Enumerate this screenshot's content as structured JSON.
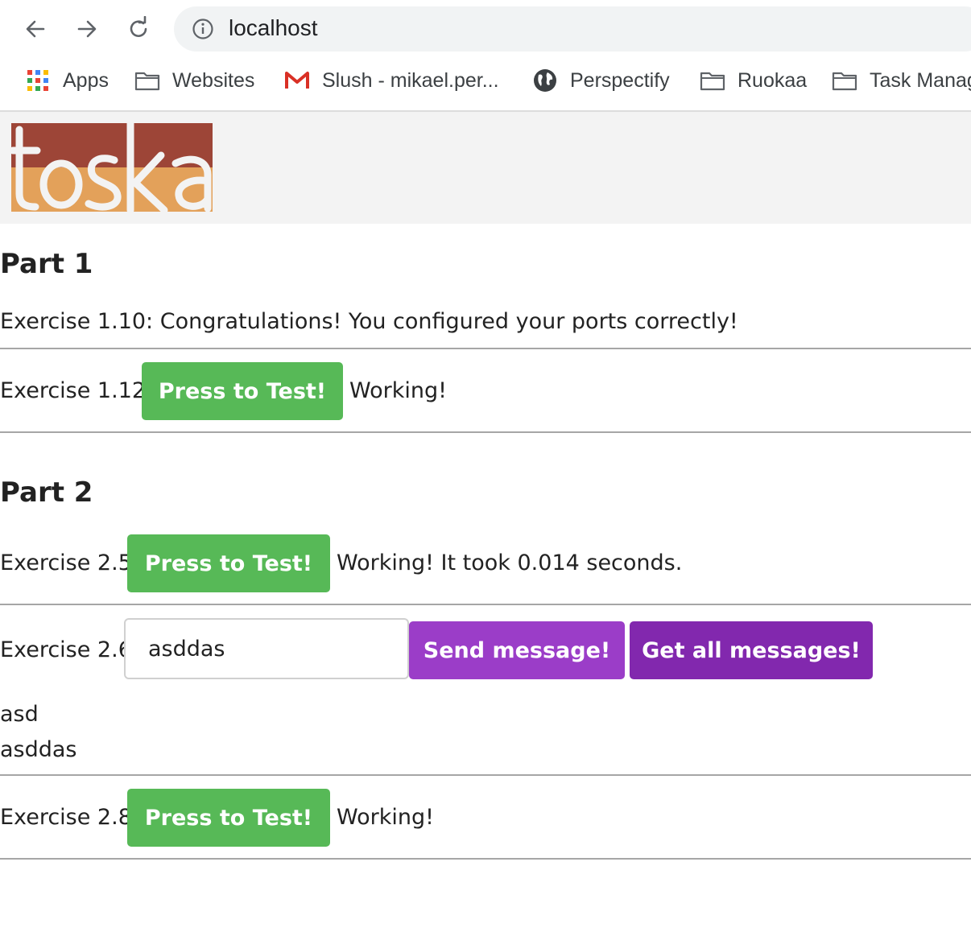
{
  "browser": {
    "url": "localhost",
    "bookmarks": [
      {
        "label": "Apps",
        "icon": "apps-grid-icon"
      },
      {
        "label": "Websites",
        "icon": "folder-icon"
      },
      {
        "label": "Slush - mikael.per...",
        "icon": "gmail-icon"
      },
      {
        "label": "Perspectify",
        "icon": "globe-icon"
      },
      {
        "label": "Ruokaa",
        "icon": "folder-icon"
      },
      {
        "label": "Task Manag",
        "icon": "folder-icon"
      }
    ]
  },
  "header": {
    "logo_text": "toska",
    "colors": {
      "top": "#9d4537",
      "bottom": "#e3a15a"
    }
  },
  "part1": {
    "title": "Part 1",
    "ex110_text": "Exercise 1.10: Congratulations! You configured your ports correctly!",
    "ex112_label": "Exercise 1.12:",
    "ex112_button": "Press to Test!",
    "ex112_result": "Working!"
  },
  "part2": {
    "title": "Part 2",
    "ex25_label": "Exercise 2.5:",
    "ex25_button": "Press to Test!",
    "ex25_result": "Working! It took 0.014 seconds.",
    "ex26_label": "Exercise 2.6:",
    "ex26_input_value": "asddas",
    "ex26_send_button": "Send message!",
    "ex26_get_button": "Get all messages!",
    "messages": [
      "asd",
      "asddas"
    ],
    "ex28_label": "Exercise 2.8:",
    "ex28_button": "Press to Test!",
    "ex28_result": "Working!"
  },
  "colors": {
    "green_button": "#57b957",
    "purple_button": "#9b3dc8",
    "purple_button_dark": "#8228ae"
  }
}
